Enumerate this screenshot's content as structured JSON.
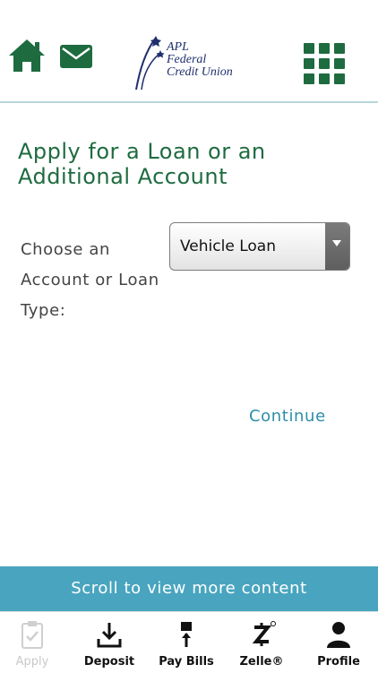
{
  "header": {
    "logo_lines": [
      "APL",
      "Federal",
      "Credit Union"
    ]
  },
  "page": {
    "title_line1": "Apply for a Loan or an",
    "title_line2": "Additional Account",
    "field_label_line1": "Choose an",
    "field_label_line2": "Account or Loan",
    "field_label_line3": "Type:",
    "select_value": "Vehicle Loan",
    "continue_label": "Continue"
  },
  "scroll_banner": "Scroll to view more content",
  "tabs": [
    {
      "label": "Apply",
      "icon": "clipboard-check-icon"
    },
    {
      "label": "Deposit",
      "icon": "download-icon"
    },
    {
      "label": "Pay Bills",
      "icon": "pay-bills-icon"
    },
    {
      "label": "Zelle®",
      "icon": "zelle-icon"
    },
    {
      "label": "Profile",
      "icon": "person-icon"
    }
  ],
  "colors": {
    "primary_green": "#1e6b40",
    "accent_teal": "#49a5bf",
    "link_blue": "#2e8ea8",
    "logo_navy": "#1f2f6e"
  }
}
